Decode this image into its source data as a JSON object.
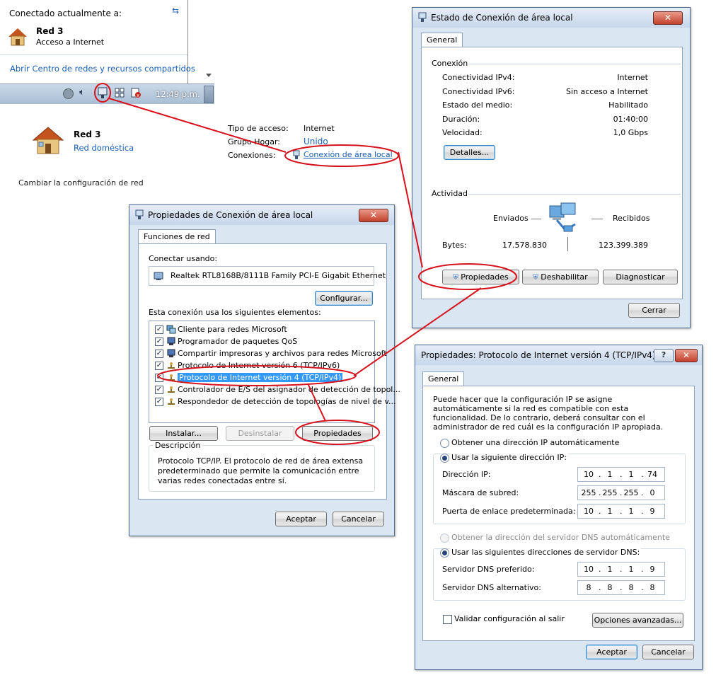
{
  "network_popup": {
    "connected_label": "Conectado actualmente a:",
    "network_name": "Red  3",
    "network_status": "Acceso a Internet",
    "open_center_link": "Abrir Centro de redes y recursos compartidos",
    "clock": "12:49 p.m."
  },
  "network_center": {
    "network_name": "Red  3",
    "network_type": "Red doméstica",
    "access_type_label": "Tipo de acceso:",
    "access_type_value": "Internet",
    "homegroup_label": "Grupo Hogar:",
    "homegroup_value": "Unido",
    "connections_label": "Conexiones:",
    "connections_value": "Conexión de área local",
    "change_settings": "Cambiar la configuración de red"
  },
  "status_dialog": {
    "title": "Estado de Conexión de área local",
    "tab": "General",
    "connection_section": "Conexión",
    "rows": [
      {
        "label": "Conectividad IPv4:",
        "value": "Internet"
      },
      {
        "label": "Conectividad IPv6:",
        "value": "Sin acceso a Internet"
      },
      {
        "label": "Estado del medio:",
        "value": "Habilitado"
      },
      {
        "label": "Duración:",
        "value": "01:40:00"
      },
      {
        "label": "Velocidad:",
        "value": "1,0 Gbps"
      }
    ],
    "details_button": "Detalles...",
    "activity_section": "Actividad",
    "sent_label": "Enviados",
    "received_label": "Recibidos",
    "bytes_label": "Bytes:",
    "bytes_sent": "17.578.830",
    "bytes_received": "123.399.389",
    "properties_button": "Propiedades",
    "disable_button": "Deshabilitar",
    "diagnose_button": "Diagnosticar",
    "close_button": "Cerrar"
  },
  "properties_dialog": {
    "title": "Propiedades de Conexión de área local",
    "tab": "Funciones de red",
    "connect_using_label": "Conectar usando:",
    "adapter_name": "Realtek RTL8168B/8111B Family PCI-E Gigabit Ethernet",
    "configure_button": "Configurar...",
    "elements_label": "Esta conexión usa los siguientes elementos:",
    "items": [
      "Cliente para redes Microsoft",
      "Programador de paquetes QoS",
      "Compartir impresoras y archivos para redes Microsoft",
      "Protocolo de Internet versión 6 (TCP/IPv6)",
      "Protocolo de Internet versión 4 (TCP/IPv4)",
      "Controlador de E/S del asignador de detección de topol...",
      "Respondedor de detección de topologías de nivel de v..."
    ],
    "install_button": "Instalar...",
    "uninstall_button": "Desinstalar",
    "properties_button": "Propiedades",
    "description_label": "Descripción",
    "description_text": "Protocolo TCP/IP. El protocolo de red de área extensa predeterminado que permite la comunicación entre varias redes conectadas entre sí.",
    "ok_button": "Aceptar",
    "cancel_button": "Cancelar"
  },
  "ipv4_dialog": {
    "title": "Propiedades: Protocolo de Internet versión 4 (TCP/IPv4)",
    "tab": "General",
    "intro": "Puede hacer que la configuración IP se asigne automáticamente si la red es compatible con esta funcionalidad. De lo contrario, deberá consultar con el administrador de red cuál es la configuración IP apropiada.",
    "auto_ip": "Obtener una dirección IP automáticamente",
    "manual_ip": "Usar la siguiente dirección IP:",
    "ip_label": "Dirección IP:",
    "ip_value": [
      "10",
      "1",
      "1",
      "74"
    ],
    "mask_label": "Máscara de subred:",
    "mask_value": [
      "255",
      "255",
      "255",
      "0"
    ],
    "gateway_label": "Puerta de enlace predeterminada:",
    "gateway_value": [
      "10",
      "1",
      "1",
      "9"
    ],
    "auto_dns": "Obtener la dirección del servidor DNS automáticamente",
    "manual_dns": "Usar las siguientes direcciones de servidor DNS:",
    "dns1_label": "Servidor DNS preferido:",
    "dns1_value": [
      "10",
      "1",
      "1",
      "9"
    ],
    "dns2_label": "Servidor DNS alternativo:",
    "dns2_value": [
      "8",
      "8",
      "8",
      "8"
    ],
    "validate_label": "Validar configuración al salir",
    "advanced_button": "Opciones avanzadas...",
    "ok_button": "Aceptar",
    "cancel_button": "Cancelar"
  },
  "colors": {
    "annotation": "#d6121d",
    "link": "#1a5fb4",
    "selection": "#3399ff",
    "window_frame": "#dbe6f3"
  }
}
